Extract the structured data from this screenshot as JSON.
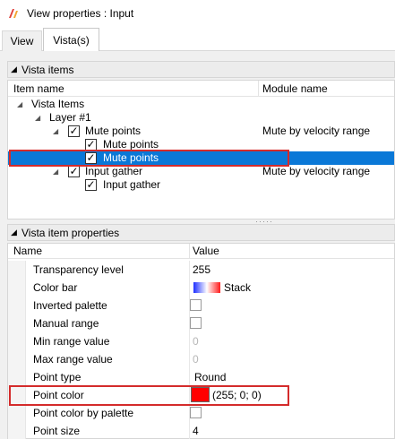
{
  "window": {
    "title": "View properties : Input",
    "icon": "app-logo-icon"
  },
  "tabs": [
    {
      "label": "View",
      "active": false
    },
    {
      "label": "Vista(s)",
      "active": true
    }
  ],
  "vista_items": {
    "header": "Vista items",
    "columns": {
      "item_name": "Item name",
      "module_name": "Module name"
    },
    "rows": [
      {
        "label": "Vista Items",
        "module": ""
      },
      {
        "label": "Layer  #1",
        "module": ""
      },
      {
        "label": "Mute points",
        "module": "Mute by velocity range",
        "checked": true
      },
      {
        "label": "Mute points",
        "module": "",
        "checked": true
      },
      {
        "label": "Mute points",
        "module": "",
        "checked": true,
        "selected": true
      },
      {
        "label": "Input gather",
        "module": "Mute by velocity range",
        "checked": true
      },
      {
        "label": "Input gather",
        "module": "",
        "checked": true
      }
    ]
  },
  "item_properties": {
    "header": "Vista item properties",
    "columns": {
      "name": "Name",
      "value": "Value"
    },
    "rows": [
      {
        "name": "Transparency level",
        "value": "255"
      },
      {
        "name": "Color bar",
        "value": "Stack"
      },
      {
        "name": "Inverted palette",
        "value": ""
      },
      {
        "name": "Manual range",
        "value": ""
      },
      {
        "name": "Min range value",
        "value": "0"
      },
      {
        "name": "Max range value",
        "value": "0"
      },
      {
        "name": "Point type",
        "value": "Round"
      },
      {
        "name": "Point color",
        "value": "(255; 0; 0)",
        "color": "#ff0000"
      },
      {
        "name": "Point color by palette",
        "value": ""
      },
      {
        "name": "Point size",
        "value": "4"
      }
    ]
  },
  "colors": {
    "selection": "#0a78d7",
    "highlight_box": "#d42b2b",
    "point_color": "#ff0000"
  }
}
